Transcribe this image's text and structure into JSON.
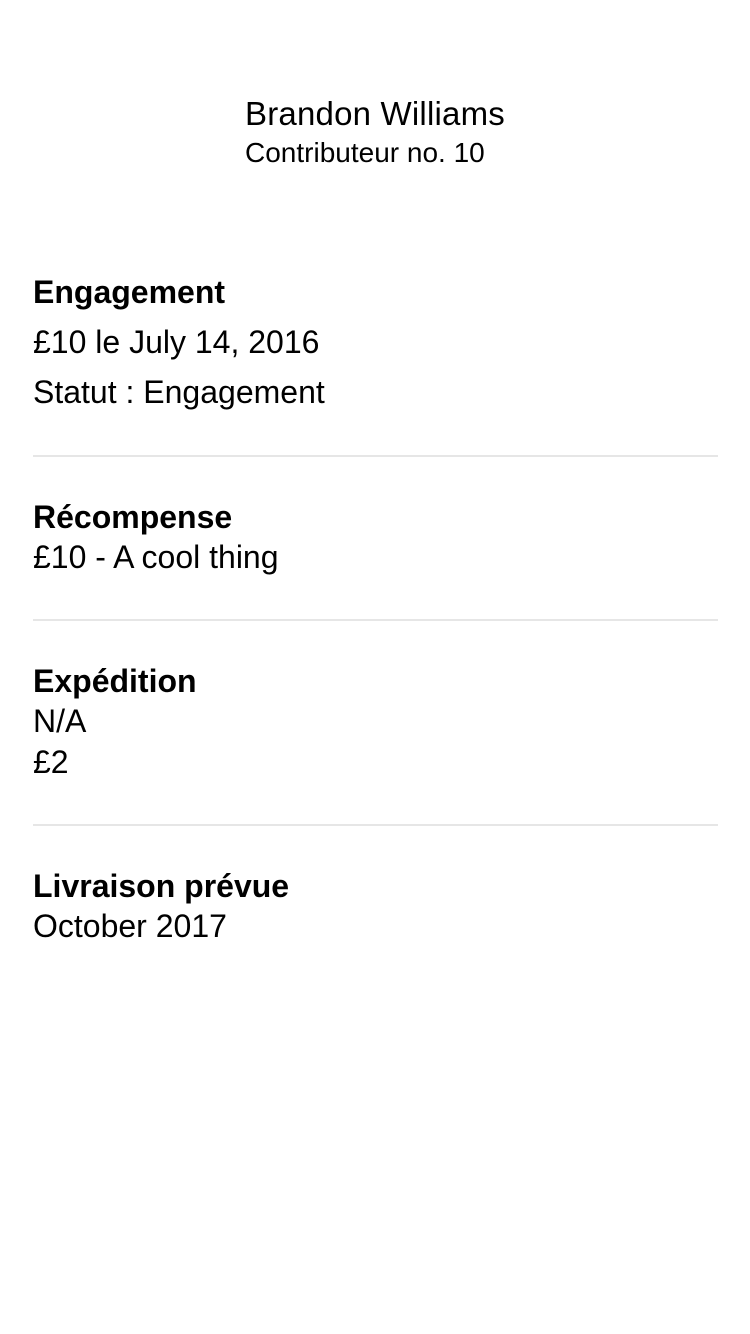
{
  "backer": {
    "name": "Brandon Williams",
    "number": "Contributeur no. 10"
  },
  "pledge": {
    "title": "Engagement",
    "amount_date": "£10 le July 14, 2016",
    "status": "Statut : Engagement"
  },
  "reward": {
    "title": "Récompense",
    "description": "£10 - A cool thing"
  },
  "shipping": {
    "title": "Expédition",
    "location": "N/A",
    "cost": "£2"
  },
  "delivery": {
    "title": "Livraison prévue",
    "date": "October 2017"
  },
  "colors": {
    "background": "#ffffff",
    "text": "#000000",
    "divider": "#e6e6e6"
  }
}
